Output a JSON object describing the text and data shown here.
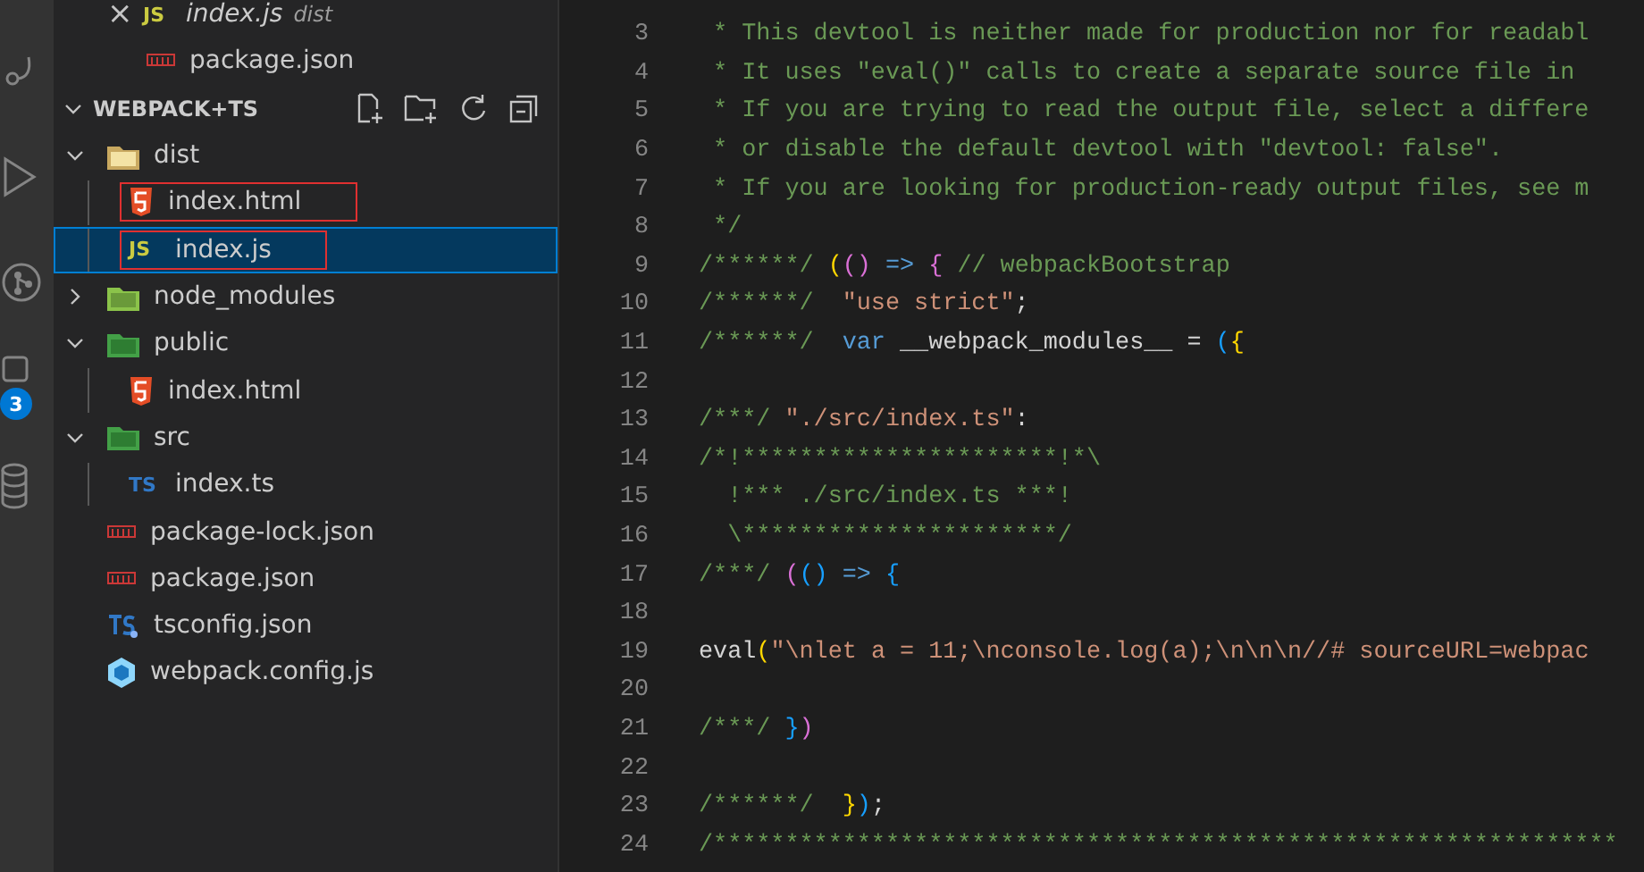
{
  "activity_bar": {
    "badge": "3"
  },
  "open_editors": [
    {
      "close": "×",
      "kind": "js",
      "glyph": "JS",
      "name": "index.js",
      "description": "dist",
      "italic": true
    },
    {
      "kind": "npm",
      "name": "package.json",
      "italic": false
    }
  ],
  "explorer": {
    "title": "WEBPACK+TS",
    "tree": [
      {
        "name": "dist",
        "kind": "folder-dist",
        "expanded": true,
        "selected": false,
        "highlighted": false,
        "children": [
          {
            "name": "index.html",
            "kind": "html",
            "selected": false,
            "highlighted": true
          },
          {
            "name": "index.js",
            "kind": "js",
            "glyph": "JS",
            "selected": true,
            "highlighted": true
          }
        ]
      },
      {
        "name": "node_modules",
        "kind": "folder-node",
        "expanded": false,
        "selected": false,
        "highlighted": false
      },
      {
        "name": "public",
        "kind": "folder-public",
        "expanded": true,
        "selected": false,
        "highlighted": false,
        "children": [
          {
            "name": "index.html",
            "kind": "html",
            "selected": false,
            "highlighted": false
          }
        ]
      },
      {
        "name": "src",
        "kind": "folder-src",
        "expanded": true,
        "selected": false,
        "highlighted": false,
        "children": [
          {
            "name": "index.ts",
            "kind": "ts",
            "glyph": "TS",
            "selected": false,
            "highlighted": false
          }
        ]
      },
      {
        "name": "package-lock.json",
        "kind": "npm",
        "selected": false,
        "highlighted": false
      },
      {
        "name": "package.json",
        "kind": "npm",
        "selected": false,
        "highlighted": false
      },
      {
        "name": "tsconfig.json",
        "kind": "tsconfig",
        "selected": false,
        "highlighted": false
      },
      {
        "name": "webpack.config.js",
        "kind": "webpack",
        "selected": false,
        "highlighted": false
      }
    ]
  },
  "editor": {
    "lines": [
      {
        "number": "3",
        "segments": [
          {
            "kind": "comment",
            "text": " * This devtool is neither made for production nor for readabl"
          }
        ]
      },
      {
        "number": "4",
        "segments": [
          {
            "kind": "comment",
            "text": " * It uses \"eval()\" calls to create a separate source file in"
          }
        ]
      },
      {
        "number": "5",
        "segments": [
          {
            "kind": "comment",
            "text": " * If you are trying to read the output file, select a differe"
          }
        ]
      },
      {
        "number": "6",
        "segments": [
          {
            "kind": "comment",
            "text": " * or disable the default devtool with \"devtool: false\"."
          }
        ]
      },
      {
        "number": "7",
        "segments": [
          {
            "kind": "comment",
            "text": " * If you are looking for production-ready output files, see m"
          }
        ]
      },
      {
        "number": "8",
        "segments": [
          {
            "kind": "comment",
            "text": " */"
          }
        ]
      },
      {
        "number": "9",
        "segments": [
          {
            "kind": "comment",
            "text": "/******/ "
          },
          {
            "kind": "gold",
            "text": "("
          },
          {
            "kind": "pink",
            "text": "()"
          },
          {
            "kind": "keyword",
            "text": " => "
          },
          {
            "kind": "pink",
            "text": "{"
          },
          {
            "kind": "comment",
            "text": " // webpackBootstrap"
          }
        ]
      },
      {
        "number": "10",
        "segments": [
          {
            "kind": "comment",
            "text": "/******/  "
          },
          {
            "kind": "string",
            "text": "\"use strict\""
          },
          {
            "kind": "plain",
            "text": ";"
          }
        ]
      },
      {
        "number": "11",
        "segments": [
          {
            "kind": "comment",
            "text": "/******/  "
          },
          {
            "kind": "keyword",
            "text": "var"
          },
          {
            "kind": "plain",
            "text": " __webpack_modules__ = "
          },
          {
            "kind": "blue",
            "text": "("
          },
          {
            "kind": "gold",
            "text": "{"
          }
        ]
      },
      {
        "number": "12"
      },
      {
        "number": "13",
        "segments": [
          {
            "kind": "comment",
            "text": "/***/ "
          },
          {
            "kind": "string",
            "text": "\"./src/index.ts\""
          },
          {
            "kind": "plain",
            "text": ":"
          }
        ]
      },
      {
        "number": "14",
        "segments": [
          {
            "kind": "comment",
            "text": "/*!**********************!*\\"
          }
        ]
      },
      {
        "number": "15",
        "segments": [
          {
            "kind": "comment",
            "text": "  !*** ./src/index.ts ***!"
          }
        ]
      },
      {
        "number": "16",
        "segments": [
          {
            "kind": "comment",
            "text": "  \\**********************/"
          }
        ]
      },
      {
        "number": "17",
        "segments": [
          {
            "kind": "comment",
            "text": "/***/ "
          },
          {
            "kind": "pink",
            "text": "("
          },
          {
            "kind": "blue",
            "text": "()"
          },
          {
            "kind": "keyword",
            "text": " => "
          },
          {
            "kind": "blue",
            "text": "{"
          }
        ]
      },
      {
        "number": "18"
      },
      {
        "number": "19",
        "segments": [
          {
            "kind": "plain",
            "text": "eval"
          },
          {
            "kind": "gold",
            "text": "("
          },
          {
            "kind": "string",
            "text": "\"\\nlet a = 11;\\nconsole.log(a);\\n\\n\\n//# sourceURL=webpac"
          }
        ]
      },
      {
        "number": "20"
      },
      {
        "number": "21",
        "segments": [
          {
            "kind": "comment",
            "text": "/***/ "
          },
          {
            "kind": "blue",
            "text": "}"
          },
          {
            "kind": "pink",
            "text": ")"
          }
        ]
      },
      {
        "number": "22"
      },
      {
        "number": "23",
        "segments": [
          {
            "kind": "comment",
            "text": "/******/  "
          },
          {
            "kind": "gold",
            "text": "}"
          },
          {
            "kind": "blue",
            "text": ")"
          },
          {
            "kind": "plain",
            "text": ";"
          }
        ]
      },
      {
        "number": "24",
        "segments": [
          {
            "kind": "comment",
            "text": "/***************************************************************"
          }
        ]
      }
    ]
  }
}
